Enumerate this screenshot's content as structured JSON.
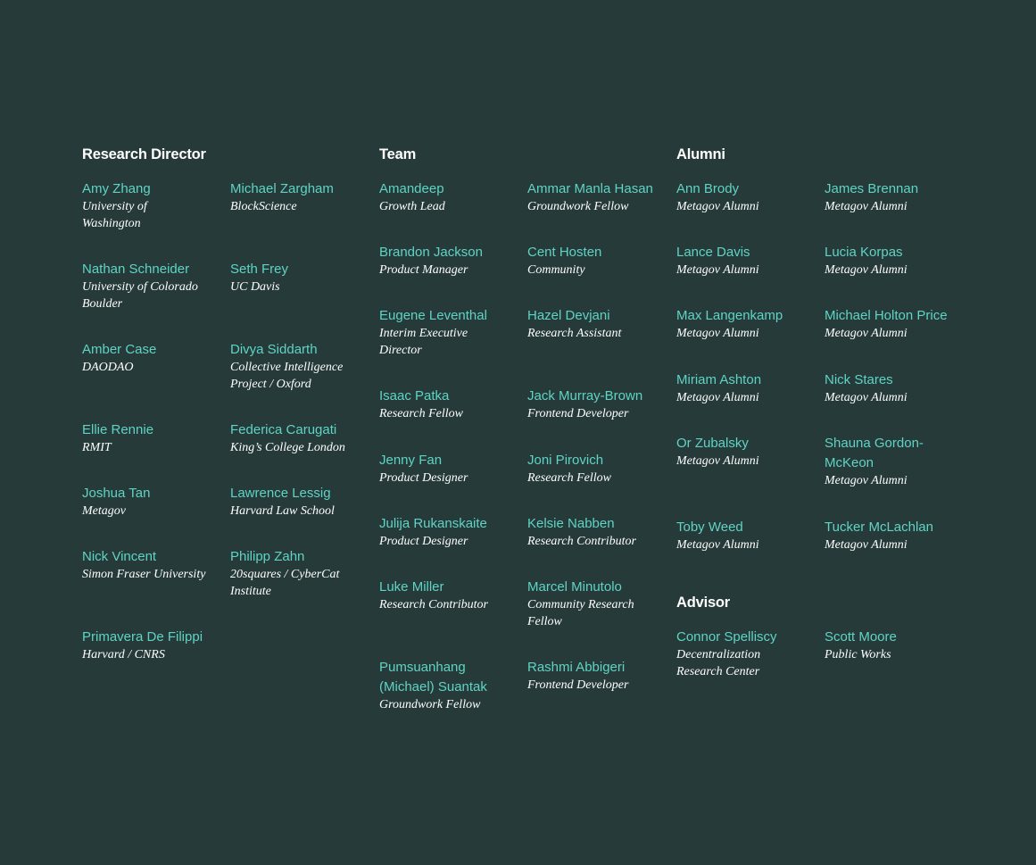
{
  "sections": {
    "research_director": {
      "heading": "Research Director",
      "people": [
        {
          "name": "Amy Zhang",
          "role": "University of Washington"
        },
        {
          "name": "Michael Zargham",
          "role": "BlockScience"
        },
        {
          "name": "Nathan Schneider",
          "role": "University of Colorado Boulder"
        },
        {
          "name": "Seth Frey",
          "role": "UC Davis"
        },
        {
          "name": "Amber Case",
          "role": "DAODAO"
        },
        {
          "name": "Divya Siddarth",
          "role": "Collective Intelligence Project / Oxford"
        },
        {
          "name": "Ellie Rennie",
          "role": "RMIT"
        },
        {
          "name": "Federica Carugati",
          "role": "King’s College London"
        },
        {
          "name": "Joshua Tan",
          "role": "Metagov"
        },
        {
          "name": "Lawrence Lessig",
          "role": "Harvard Law School"
        },
        {
          "name": "Nick Vincent",
          "role": "Simon Fraser University"
        },
        {
          "name": "Philipp Zahn",
          "role": "20squares / CyberCat Institute"
        },
        {
          "name": "Primavera De Filippi",
          "role": "Harvard / CNRS"
        }
      ]
    },
    "team": {
      "heading": "Team",
      "people": [
        {
          "name": "Amandeep",
          "role": "Growth Lead"
        },
        {
          "name": "Ammar Manla Hasan",
          "role": "Groundwork Fellow"
        },
        {
          "name": "Brandon Jackson",
          "role": "Product Manager"
        },
        {
          "name": "Cent Hosten",
          "role": "Community"
        },
        {
          "name": "Eugene Leventhal",
          "role": "Interim Executive Director"
        },
        {
          "name": "Hazel Devjani",
          "role": "Research Assistant"
        },
        {
          "name": "Isaac Patka",
          "role": "Research Fellow"
        },
        {
          "name": "Jack Murray-Brown",
          "role": "Frontend Developer"
        },
        {
          "name": "Jenny Fan",
          "role": "Product Designer"
        },
        {
          "name": "Joni Pirovich",
          "role": "Research Fellow"
        },
        {
          "name": "Julija Rukanskaite",
          "role": "Product Designer"
        },
        {
          "name": "Kelsie Nabben",
          "role": "Research Contributor"
        },
        {
          "name": "Luke Miller",
          "role": "Research Contributor"
        },
        {
          "name": "Marcel Minutolo",
          "role": "Community Research Fellow"
        },
        {
          "name": "Pumsuanhang (Michael) Suantak",
          "role": "Groundwork Fellow"
        },
        {
          "name": "Rashmi Abbigeri",
          "role": "Frontend Developer"
        }
      ]
    },
    "alumni": {
      "heading": "Alumni",
      "people": [
        {
          "name": "Ann Brody",
          "role": "Metagov Alumni"
        },
        {
          "name": "James Brennan",
          "role": "Metagov Alumni"
        },
        {
          "name": "Lance Davis",
          "role": "Metagov Alumni"
        },
        {
          "name": "Lucia Korpas",
          "role": "Metagov Alumni"
        },
        {
          "name": "Max Langenkamp",
          "role": "Metagov Alumni"
        },
        {
          "name": "Michael Holton Price",
          "role": "Metagov Alumni"
        },
        {
          "name": "Miriam Ashton",
          "role": "Metagov Alumni"
        },
        {
          "name": "Nick Stares",
          "role": "Metagov Alumni"
        },
        {
          "name": "Or Zubalsky",
          "role": "Metagov Alumni"
        },
        {
          "name": "Shauna Gordon-McKeon",
          "role": "Metagov Alumni"
        },
        {
          "name": "Toby Weed",
          "role": "Metagov Alumni"
        },
        {
          "name": "Tucker McLachlan",
          "role": "Metagov Alumni"
        }
      ]
    },
    "advisor": {
      "heading": "Advisor",
      "people": [
        {
          "name": "Connor Spelliscy",
          "role": "Decentralization Research Center"
        },
        {
          "name": "Scott Moore",
          "role": "Public Works"
        }
      ]
    }
  }
}
